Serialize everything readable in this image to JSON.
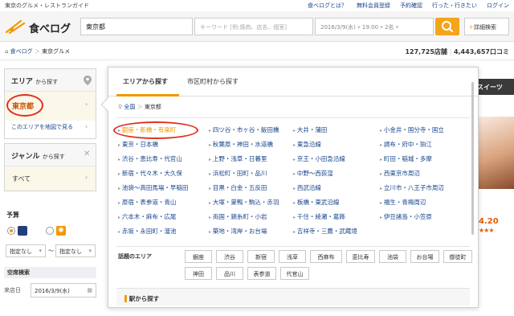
{
  "topbar": {
    "tagline": "東京のグルメ・レストランガイド",
    "links": [
      "食べログとは？",
      "無料会員登録",
      "予約確認",
      "行った・行きたい",
      "ログイン"
    ]
  },
  "header": {
    "logo_text": "食べログ",
    "area_value": "東京都",
    "keyword_placeholder": "キーワード [例:焼肉、店名、個室]",
    "date_value": "2016/3/9(水)",
    "time_value": "19:00",
    "people_value": "2名",
    "detail_button": "詳細検索",
    "accent": "#f5a51a"
  },
  "crumbs": {
    "items": [
      "食べログ",
      "東京グルメ"
    ],
    "store_count": "127,725店舗",
    "review_count": "4,443,657口コミ"
  },
  "left": {
    "area_title": "エリア",
    "area_suffix": "から探す",
    "area_selected": "東京都",
    "area_map_link": "このエリアを地図で見る",
    "genre_title": "ジャンル",
    "genre_suffix": "から探す",
    "genre_selected": "すべて",
    "budget_title": "予算",
    "budget_from": "指定なし",
    "budget_sep": "〜",
    "budget_to": "指定なし",
    "vacancy_title": "空席検索",
    "visit_label": "来店日",
    "visit_value": "2016/3/9(水)"
  },
  "right": {
    "sweets_label": "スイーツ",
    "rating": "4.20",
    "stars": "★★★"
  },
  "panel": {
    "tab_area": "エリアから探す",
    "tab_city": "市区町村から探す",
    "breadcrumb_all": "全国",
    "breadcrumb_current": "東京都",
    "areas": [
      "銀座・新橋・有楽町",
      "東京・日本橋",
      "渋谷・恵比寿・代官山",
      "新宿・代々木・大久保",
      "池袋〜高田馬場・早稲田",
      "原宿・表参道・青山",
      "六本木・麻布・広尾",
      "赤坂・永田町・溜池",
      "四ツ谷・市ヶ谷・飯田橋",
      "秋葉原・神田・水道橋",
      "上野・浅草・日暮里",
      "浜松町・田町・品川",
      "目黒・白金・五反田",
      "大塚・巣鴨・駒込・赤羽",
      "両国・錦糸町・小岩",
      "築地・湾岸・お台場",
      "大井・蒲田",
      "東急沿線",
      "京王・小田急沿線",
      "中野〜西荻窪",
      "西武沿線",
      "板橋・東武沿線",
      "千住・綾瀬・葛飾",
      "吉祥寺・三鷹・武蔵境",
      "小金井・国分寺・国立",
      "調布・府中・狛江",
      "町田・稲城・多摩",
      "西東京市周辺",
      "立川市・八王子市周辺",
      "福生・青梅周辺",
      "伊豆諸島・小笠原"
    ],
    "wadai_title": "話題のエリア",
    "wadai": [
      "銀座",
      "渋谷",
      "新宿",
      "浅草",
      "西麻布",
      "恵比寿",
      "池袋",
      "お台場",
      "御徒町",
      "神田",
      "品川",
      "表参道",
      "代官山"
    ],
    "eki_label": "駅から探す"
  }
}
